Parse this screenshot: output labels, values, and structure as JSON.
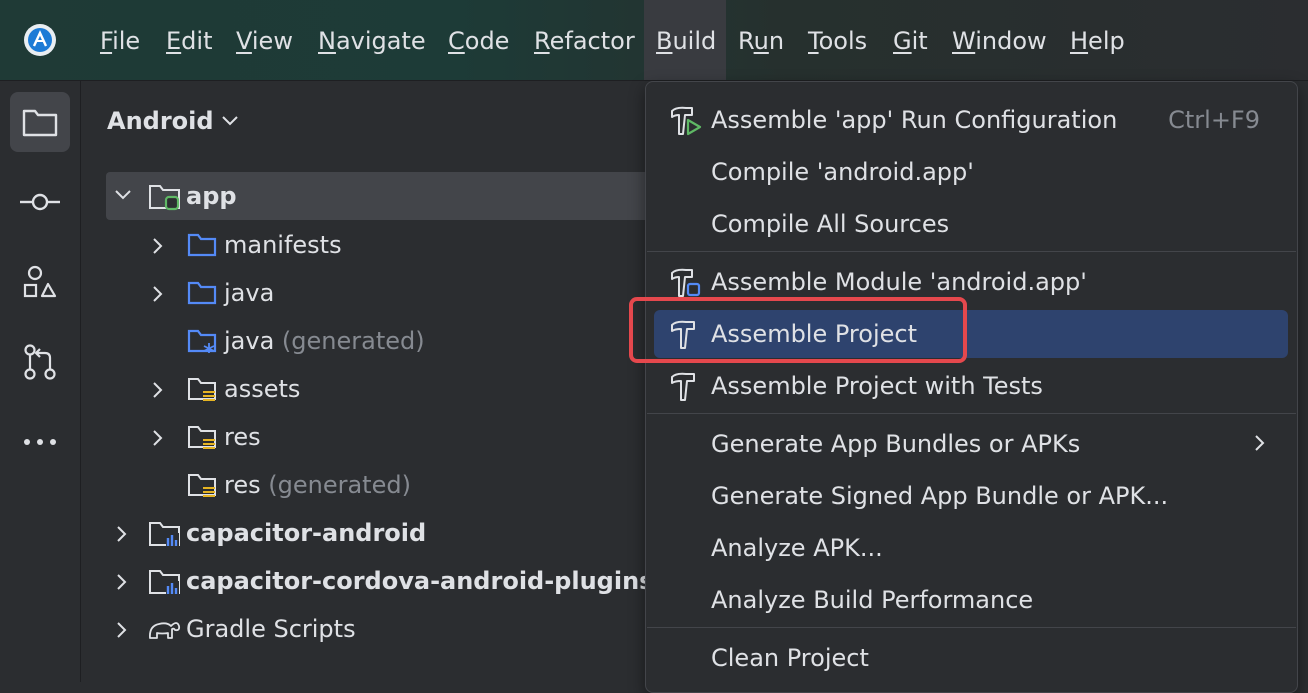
{
  "menubar": {
    "items": [
      {
        "pre": "",
        "u": "F",
        "post": "ile"
      },
      {
        "pre": "",
        "u": "E",
        "post": "dit"
      },
      {
        "pre": "",
        "u": "V",
        "post": "iew"
      },
      {
        "pre": "",
        "u": "N",
        "post": "avigate"
      },
      {
        "pre": "",
        "u": "C",
        "post": "ode"
      },
      {
        "pre": "",
        "u": "R",
        "post": "efactor"
      },
      {
        "pre": "",
        "u": "B",
        "post": "uild"
      },
      {
        "pre": "R",
        "u": "u",
        "post": "n"
      },
      {
        "pre": "",
        "u": "T",
        "post": "ools"
      },
      {
        "pre": "",
        "u": "G",
        "post": "it"
      },
      {
        "pre": "",
        "u": "W",
        "post": "indow"
      },
      {
        "pre": "",
        "u": "H",
        "post": "elp"
      }
    ]
  },
  "project_panel": {
    "title": "Android",
    "tree": [
      {
        "label": "app",
        "suffix": "",
        "bold": true,
        "expanded": true
      },
      {
        "label": "manifests",
        "suffix": ""
      },
      {
        "label": "java",
        "suffix": ""
      },
      {
        "label": "java",
        "suffix": " (generated)"
      },
      {
        "label": "assets",
        "suffix": ""
      },
      {
        "label": "res",
        "suffix": ""
      },
      {
        "label": "res",
        "suffix": " (generated)"
      },
      {
        "label": "capacitor-android",
        "suffix": "",
        "bold": true
      },
      {
        "label": "capacitor-cordova-android-plugins",
        "suffix": "",
        "bold": true
      },
      {
        "label": "Gradle Scripts",
        "suffix": ""
      }
    ]
  },
  "build_menu": {
    "items": [
      {
        "label": "Assemble 'app' Run Configuration",
        "shortcut": "Ctrl+F9",
        "icon": "hammer-run-icon"
      },
      {
        "label": "Compile 'android.app'",
        "shortcut": "",
        "icon": ""
      },
      {
        "label": "Compile All Sources",
        "shortcut": "",
        "icon": ""
      },
      {
        "label": "Assemble Module 'android.app'",
        "shortcut": "",
        "icon": "hammer-module-icon"
      },
      {
        "label": "Assemble Project",
        "shortcut": "",
        "icon": "hammer-icon",
        "highlighted": true
      },
      {
        "label": "Assemble Project with Tests",
        "shortcut": "",
        "icon": "hammer-icon"
      },
      {
        "label": "Generate App Bundles or APKs",
        "shortcut": "",
        "submenu": true
      },
      {
        "label": "Generate Signed App Bundle or APK...",
        "shortcut": ""
      },
      {
        "label": "Analyze APK...",
        "shortcut": ""
      },
      {
        "label": "Analyze Build Performance",
        "shortcut": ""
      },
      {
        "label": "Clean Project",
        "shortcut": ""
      }
    ]
  },
  "colors": {
    "accent_highlight": "#2e436e",
    "annotation_red": "#e5484d",
    "folder_blue": "#548af7",
    "resource_yellow": "#e6b422",
    "module_green": "#5fb865"
  }
}
